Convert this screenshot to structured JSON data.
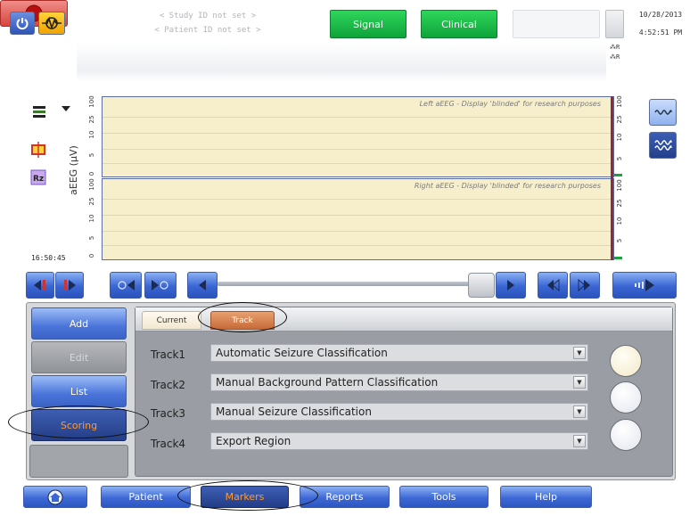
{
  "header": {
    "study_id": "< Study ID not set >",
    "patient_id": "< Patient ID not set >",
    "signal_label": "Signal",
    "clinical_label": "Clinical",
    "date": "10/28/2013",
    "time": "4:52:51 PM",
    "r_label_1": "R",
    "r_label_2": "R"
  },
  "plot": {
    "ylabel": "aEEG (µV)",
    "left_title": "Left aEEG  - Display 'blinded' for research purposes",
    "right_title": "Right aEEG - Display 'blinded' for research purposes",
    "ticks": [
      "100",
      "25",
      "10",
      "5",
      "0"
    ],
    "right_ticks": [
      "100",
      "25",
      "10",
      "5"
    ],
    "time_label": "16:50:45"
  },
  "side_menu": {
    "add": "Add",
    "edit": "Edit",
    "list": "List",
    "scoring": "Scoring"
  },
  "tabs": {
    "current": "Current",
    "track": "Track"
  },
  "tracks": [
    {
      "label": "Track1",
      "value": "Automatic Seizure Classification"
    },
    {
      "label": "Track2",
      "value": "Manual Background Pattern Classification"
    },
    {
      "label": "Track3",
      "value": "Manual Seizure Classification"
    },
    {
      "label": "Track4",
      "value": "Export Region"
    }
  ],
  "bottom_bar": {
    "patient": "Patient",
    "markers": "Markers",
    "reports": "Reports",
    "tools": "Tools",
    "help": "Help"
  },
  "icons": [
    "power-icon",
    "monitor-icon",
    "layout-icon",
    "dropdown-triangle-icon",
    "crop-icon",
    "rz-icon",
    "wave-icon",
    "double-wave-icon",
    "home-icon",
    "record-icon"
  ],
  "colors": {
    "accent_blue": "#3a66d3",
    "signal_green": "#0ea33a",
    "plot_background": "#f7efcc",
    "active_orange": "#ff9a2e",
    "record_red": "#d8453d"
  }
}
